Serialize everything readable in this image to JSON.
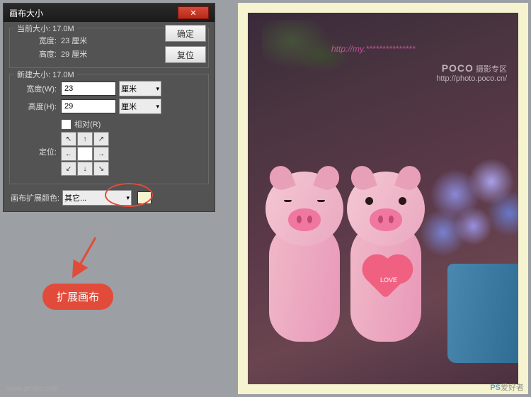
{
  "dialog": {
    "title": "画布大小",
    "ok": "确定",
    "cancel": "复位",
    "current": {
      "legend": "当前大小: 17.0M",
      "width_label": "宽度:",
      "width_val": "23 厘米",
      "height_label": "高度:",
      "height_val": "29 厘米"
    },
    "newsize": {
      "legend": "新建大小: 17.0M",
      "width_label": "宽度(W):",
      "width_val": "23",
      "height_label": "高度(H):",
      "height_val": "29",
      "unit": "厘米",
      "relative": "相对(R)",
      "anchor_label": "定位:"
    },
    "ext_color_label": "画布扩展颜色:",
    "ext_color_val": "其它...",
    "ext_swatch": "#f5f3d0"
  },
  "annotations": {
    "badge": "扩展画布"
  },
  "watermarks": {
    "top_pink": "http://my.***************",
    "poco_brand": "POCO",
    "poco_sub": "摄影专区",
    "poco_url": "http://photo.poco.cn/",
    "site_zh": "爱好者",
    "site_url": "www.psahz.com"
  },
  "heart_text": "LOVE"
}
